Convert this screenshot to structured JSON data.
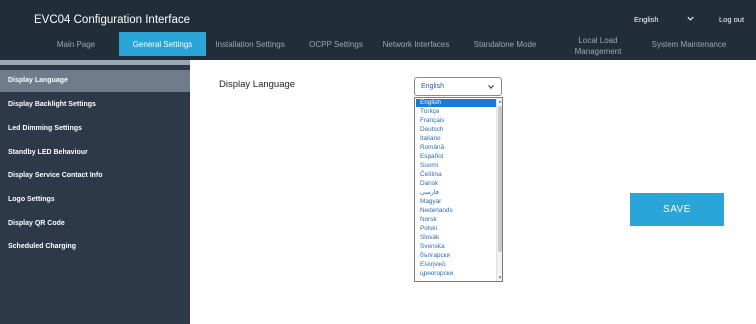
{
  "header": {
    "title": "EVC04 Configuration Interface",
    "language": "English",
    "logout": "Log out"
  },
  "nav": {
    "tabs": [
      {
        "label": "Main Page",
        "active": false
      },
      {
        "label": "General Settings",
        "active": true
      },
      {
        "label": "Installation Settings",
        "active": false
      },
      {
        "label": "OCPP Settings",
        "active": false
      },
      {
        "label": "Network Interfaces",
        "active": false
      },
      {
        "label": "Standalone Mode",
        "active": false
      },
      {
        "label": "Local Load Management",
        "active": false
      },
      {
        "label": "System Maintenance",
        "active": false
      }
    ]
  },
  "sidebar": {
    "items": [
      {
        "label": "Display Language",
        "active": true
      },
      {
        "label": "Display Backlight Settings",
        "active": false
      },
      {
        "label": "Led Dimming Settings",
        "active": false
      },
      {
        "label": "Standby LED Behaviour",
        "active": false
      },
      {
        "label": "Display Service Contact Info",
        "active": false
      },
      {
        "label": "Logo Settings",
        "active": false
      },
      {
        "label": "Display QR Code",
        "active": false
      },
      {
        "label": "Scheduled Charging",
        "active": false
      }
    ]
  },
  "main": {
    "label": "Display Language",
    "select_value": "English",
    "options": [
      "English",
      "Türkçe",
      "Français",
      "Deutsch",
      "Italiano",
      "Română",
      "Español",
      "Suomi",
      "Čeština",
      "Dansk",
      "فارسی",
      "Magyar",
      "Nederlands",
      "Norsk",
      "Polski",
      "Slovák",
      "Svenska",
      "български",
      "Ελληνικό",
      "црногорски"
    ],
    "selected_option": "English",
    "save_label": "SAVE"
  },
  "colors": {
    "topbar": "#222d3a",
    "sidebar": "#2d3948",
    "sidebar_active": "#6f7c8c",
    "accent": "#2ba4d7",
    "option_text": "#2b6cb6",
    "option_selected": "#1e77d4"
  }
}
